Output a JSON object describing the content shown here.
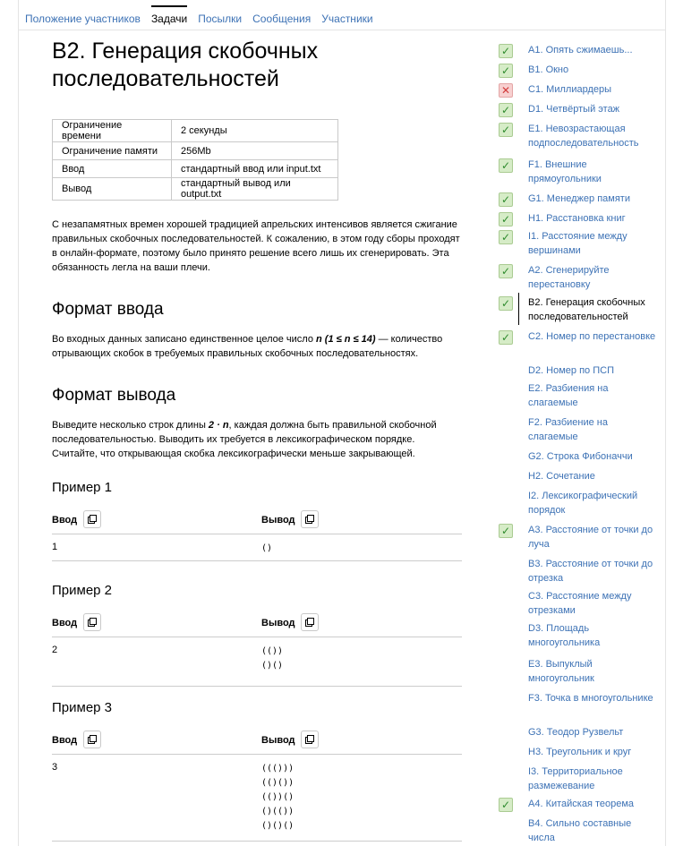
{
  "tabs": [
    "Положение участников",
    "Задачи",
    "Посылки",
    "Сообщения",
    "Участники"
  ],
  "active_tab": 1,
  "title": "B2. Генерация скобочных последовательностей",
  "limits": [
    [
      "Ограничение времени",
      "2 секунды"
    ],
    [
      "Ограничение памяти",
      "256Mb"
    ],
    [
      "Ввод",
      "стандартный ввод или input.txt"
    ],
    [
      "Вывод",
      "стандартный вывод или output.txt"
    ]
  ],
  "statement": "С незапамятных времен хорошей традицией апрельских интенсивов является сжигание правильных скобочных последовательностей. К сожалению, в этом году сборы проходят в онлайн-формате, поэтому было принято решение всего лишь их сгенерировать. Эта обязанность легла на ваши плечи.",
  "input_title": "Формат ввода",
  "input_text": {
    "before": "Во входных данных записано единственное целое число ",
    "math": "n (1 ≤ n ≤ 14)",
    "after": " — количество отрывающих скобок в требуемых правильных скобочных последовательностях."
  },
  "output_title": "Формат вывода",
  "output_text": {
    "before": "Выведите несколько строк длины ",
    "math": "2 · n",
    "after": ", каждая должна быть правильной скобочной последовательностью. Выводить их требуется в лексикографическом порядке. Считайте, что открывающая скобка лексикографически меньше закрывающей."
  },
  "examples_labels": {
    "input": "Ввод",
    "output": "Вывод"
  },
  "examples": [
    {
      "title": "Пример 1",
      "input": "1",
      "output": [
        "()"
      ]
    },
    {
      "title": "Пример 2",
      "input": "2",
      "output": [
        "(())",
        "()()"
      ]
    },
    {
      "title": "Пример 3",
      "input": "3",
      "output": [
        "((()))",
        "(()())",
        "(())()",
        "()(())",
        "()()()"
      ]
    }
  ],
  "problems": [
    {
      "label": "A1. Опять сжимаешь...",
      "status": "ok"
    },
    {
      "label": "B1. Окно",
      "status": "ok"
    },
    {
      "label": "C1. Миллиардеры",
      "status": "bad"
    },
    {
      "label": "D1. Четвёртый этаж",
      "status": "ok"
    },
    {
      "label": "E1. Невозрастающая подпоследовательность",
      "status": "ok"
    },
    {
      "label": "F1. Внешние прямоугольники",
      "status": "ok"
    },
    {
      "label": "G1. Менеджер памяти",
      "status": "ok"
    },
    {
      "label": "H1. Расстановка книг",
      "status": "ok"
    },
    {
      "label": "I1. Расстояние между вершинами",
      "status": "ok"
    },
    {
      "label": "A2. Сгенерируйте перестановку",
      "status": "ok"
    },
    {
      "label": "B2. Генерация скобочных последовательностей",
      "status": "ok",
      "current": true
    },
    {
      "label": "C2. Номер по перестановке",
      "status": "ok"
    },
    {
      "label": "D2. Номер по ПСП",
      "status": "none"
    },
    {
      "label": "E2. Разбиения на слагаемые",
      "status": "none"
    },
    {
      "label": "F2. Разбиение на слагаемые",
      "status": "none"
    },
    {
      "label": "G2. Строка Фибоначчи",
      "status": "none"
    },
    {
      "label": "H2. Сочетание",
      "status": "none"
    },
    {
      "label": "I2. Лексикографический порядок",
      "status": "none"
    },
    {
      "label": "A3. Расстояние от точки до луча",
      "status": "ok"
    },
    {
      "label": "B3. Расстояние от точки до отрезка",
      "status": "none"
    },
    {
      "label": "C3. Расстояние между отрезками",
      "status": "none"
    },
    {
      "label": "D3. Площадь многоугольника",
      "status": "none"
    },
    {
      "label": "E3. Выпуклый многоугольник",
      "status": "none"
    },
    {
      "label": "F3. Точка в многоугольнике",
      "status": "none"
    },
    {
      "label": "G3. Теодор Рузвельт",
      "status": "none"
    },
    {
      "label": "H3. Треугольник и круг",
      "status": "none"
    },
    {
      "label": "I3. Территориальное размежевание",
      "status": "none"
    },
    {
      "label": "A4. Китайская теорема",
      "status": "ok"
    },
    {
      "label": "B4. Сильно составные числа",
      "status": "none"
    }
  ],
  "icons": {
    "ok": "check-icon",
    "bad": "cross-icon",
    "copy": "copy-icon"
  }
}
